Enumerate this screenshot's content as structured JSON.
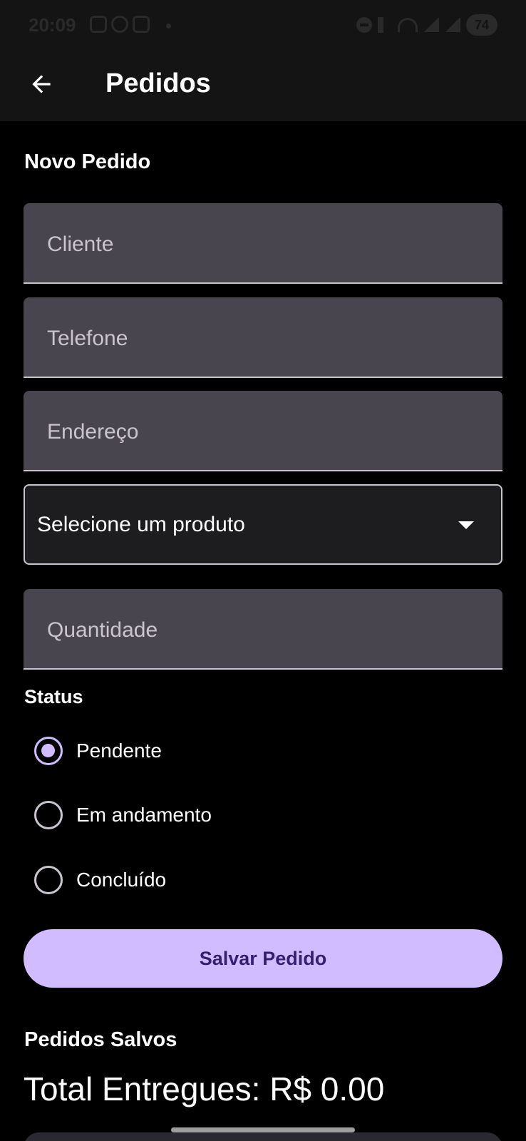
{
  "status_bar": {
    "time": "20:09",
    "battery": "74"
  },
  "app_bar": {
    "title": "Pedidos"
  },
  "form": {
    "section_title": "Novo Pedido",
    "cliente_placeholder": "Cliente",
    "telefone_placeholder": "Telefone",
    "endereco_placeholder": "Endereço",
    "produto_dropdown_value": "Selecione um produto",
    "quantidade_placeholder": "Quantidade",
    "status_label": "Status",
    "status_options": [
      {
        "label": "Pendente",
        "checked": true
      },
      {
        "label": "Em andamento",
        "checked": false
      },
      {
        "label": "Concluído",
        "checked": false
      }
    ],
    "save_label": "Salvar Pedido"
  },
  "saved": {
    "section_title": "Pedidos Salvos",
    "total_text": "Total Entregues: R$ 0.00"
  },
  "colors": {
    "accent": "#d0bcff",
    "on_accent": "#381e72",
    "field_bg": "#49454f",
    "app_bar_bg": "#141414",
    "background": "#000000"
  }
}
